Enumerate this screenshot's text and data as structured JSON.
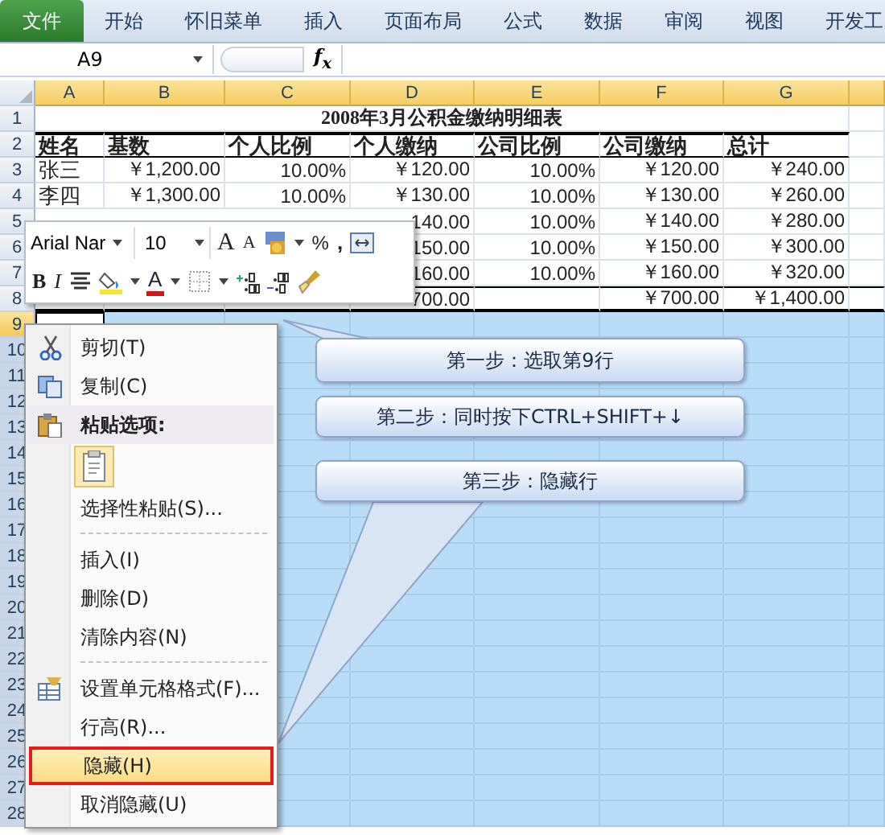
{
  "ribbon_tabs": [
    {
      "label": "文件",
      "kind": "file"
    },
    {
      "label": "开始",
      "kind": "tab"
    },
    {
      "label": "怀旧菜单",
      "kind": "tab"
    },
    {
      "label": "插入",
      "kind": "tab"
    },
    {
      "label": "页面布局",
      "kind": "tab"
    },
    {
      "label": "公式",
      "kind": "tab"
    },
    {
      "label": "数据",
      "kind": "tab"
    },
    {
      "label": "审阅",
      "kind": "tab"
    },
    {
      "label": "视图",
      "kind": "tab"
    },
    {
      "label": "开发工",
      "kind": "tab"
    }
  ],
  "formula_bar": {
    "name_box": "A9",
    "function_button": "f$_{x}$"
  },
  "columns": [
    "A",
    "B",
    "C",
    "D",
    "E",
    "F",
    "G"
  ],
  "rows": [
    {
      "number": "1",
      "kind": "title",
      "selected": false,
      "active": false,
      "title": "2008年3月公积金缴纳明细表"
    },
    {
      "number": "2",
      "kind": "header",
      "selected": false,
      "active": false,
      "cells": [
        "姓名",
        "基数",
        "个人比例",
        "个人缴纳",
        "公司比例",
        "公司缴纳",
        "总计"
      ]
    },
    {
      "number": "3",
      "kind": "data",
      "selected": false,
      "active": false,
      "cells": [
        "张三",
        "￥1,200.00",
        "10.00%",
        "￥120.00",
        "10.00%",
        "￥120.00",
        "￥240.00"
      ]
    },
    {
      "number": "4",
      "kind": "data",
      "selected": false,
      "active": false,
      "cells": [
        "李四",
        "￥1,300.00",
        "10.00%",
        "￥130.00",
        "10.00%",
        "￥130.00",
        "￥260.00"
      ]
    },
    {
      "number": "5",
      "kind": "data",
      "selected": false,
      "active": false,
      "cells": [
        null,
        null,
        null,
        "140.00",
        "10.00%",
        "￥140.00",
        "￥280.00"
      ]
    },
    {
      "number": "6",
      "kind": "data",
      "selected": false,
      "active": false,
      "cells": [
        null,
        null,
        null,
        "150.00",
        "10.00%",
        "￥150.00",
        "￥300.00"
      ]
    },
    {
      "number": "7",
      "kind": "data",
      "selected": false,
      "active": false,
      "cells": [
        null,
        null,
        null,
        "160.00",
        "10.00%",
        "￥160.00",
        "￥320.00"
      ]
    },
    {
      "number": "8",
      "kind": "total",
      "selected": false,
      "active": false,
      "cells": [
        null,
        null,
        null,
        "700.00",
        null,
        "￥700.00",
        "￥1,400.00"
      ]
    },
    {
      "number": "9",
      "kind": "data",
      "selected": true,
      "active": true
    },
    {
      "number": "10",
      "kind": "data",
      "selected": true,
      "active": false
    },
    {
      "number": "11",
      "kind": "data",
      "selected": true,
      "active": false
    },
    {
      "number": "12",
      "kind": "data",
      "selected": true,
      "active": false
    },
    {
      "number": "13",
      "kind": "data",
      "selected": true,
      "active": false
    },
    {
      "number": "14",
      "kind": "data",
      "selected": true,
      "active": false
    },
    {
      "number": "15",
      "kind": "data",
      "selected": true,
      "active": false
    },
    {
      "number": "16",
      "kind": "data",
      "selected": true,
      "active": false
    },
    {
      "number": "17",
      "kind": "data",
      "selected": true,
      "active": false
    },
    {
      "number": "18",
      "kind": "data",
      "selected": true,
      "active": false
    },
    {
      "number": "19",
      "kind": "data",
      "selected": true,
      "active": false
    },
    {
      "number": "20",
      "kind": "data",
      "selected": true,
      "active": false
    },
    {
      "number": "21",
      "kind": "data",
      "selected": true,
      "active": false
    },
    {
      "number": "22",
      "kind": "data",
      "selected": true,
      "active": false
    },
    {
      "number": "23",
      "kind": "data",
      "selected": true,
      "active": false
    },
    {
      "number": "24",
      "kind": "data",
      "selected": true,
      "active": false
    },
    {
      "number": "25",
      "kind": "data",
      "selected": true,
      "active": false
    },
    {
      "number": "26",
      "kind": "data",
      "selected": true,
      "active": false
    },
    {
      "number": "27",
      "kind": "data",
      "selected": true,
      "active": false
    },
    {
      "number": "28",
      "kind": "data",
      "selected": true,
      "active": false
    }
  ],
  "mini_toolbar": {
    "font": "Arial Nar",
    "size": "10",
    "row_1": [
      {
        "kind": "grow",
        "label": "A"
      },
      {
        "kind": "shrink",
        "label": "A"
      },
      {
        "kind": "accounting"
      },
      {
        "kind": "percent",
        "label": "%"
      },
      {
        "kind": "comma",
        "label": ","
      },
      {
        "kind": "merge"
      }
    ],
    "row_2": [
      {
        "kind": "bold",
        "label": "B"
      },
      {
        "kind": "italic",
        "label": "I"
      },
      {
        "kind": "center"
      },
      {
        "kind": "fill"
      },
      {
        "kind": "font_color",
        "label": "A"
      },
      {
        "kind": "border"
      },
      {
        "kind": "inc_decimal"
      },
      {
        "kind": "dec_decimal"
      },
      {
        "kind": "painter"
      }
    ]
  },
  "context_menu": [
    {
      "kind": "cut",
      "label": "剪切(T)",
      "selected": false
    },
    {
      "kind": "copy",
      "label": "复制(C)",
      "selected": false
    },
    {
      "kind": "heading",
      "label": "粘贴选项:",
      "selected": false
    },
    {
      "kind": "paste_buttons"
    },
    {
      "kind": "item",
      "label": "选择性粘贴(S)...",
      "selected": false
    },
    {
      "kind": "separator"
    },
    {
      "kind": "item",
      "label": "插入(I)",
      "selected": false
    },
    {
      "kind": "item",
      "label": "删除(D)",
      "selected": false
    },
    {
      "kind": "item",
      "label": "清除内容(N)",
      "selected": false
    },
    {
      "kind": "separator"
    },
    {
      "kind": "format_cells",
      "label": "设置单元格格式(F)...",
      "selected": false
    },
    {
      "kind": "item",
      "label": "行高(R)...",
      "selected": false
    },
    {
      "kind": "item",
      "label": "隐藏(H)",
      "selected": true
    },
    {
      "kind": "item",
      "label": "取消隐藏(U)",
      "selected": false
    }
  ],
  "callouts": [
    "第一步：选取第9行",
    "第二步：同时按下CTRL+SHIFT+↓",
    "第三步：隐藏行"
  ]
}
